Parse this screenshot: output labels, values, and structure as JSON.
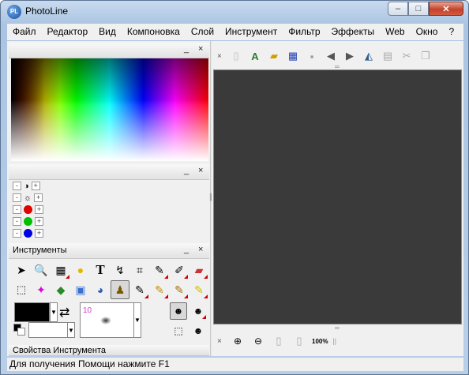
{
  "window": {
    "title": "PhotoLine",
    "app_icon": "PL"
  },
  "window_controls": {
    "minimize": "–",
    "maximize": "□",
    "close": "✕"
  },
  "menu": [
    "Файл",
    "Редактор",
    "Вид",
    "Компоновка",
    "Слой",
    "Инструмент",
    "Фильтр",
    "Эффекты",
    "Web",
    "Окно",
    "?"
  ],
  "panels": {
    "color": {
      "minimize": "_",
      "close": "×"
    },
    "adjust": {
      "minimize": "_",
      "close": "×",
      "rows": [
        {
          "name": "contrast",
          "glyph": "◑"
        },
        {
          "name": "brightness",
          "glyph": "☼"
        },
        {
          "name": "red",
          "color": "#e00000"
        },
        {
          "name": "green",
          "color": "#00c000"
        },
        {
          "name": "blue",
          "color": "#0000e0"
        }
      ],
      "minus": "-",
      "plus": "+"
    },
    "tools": {
      "title": "Инструменты",
      "minimize": "_",
      "close": "×",
      "brush_size": "10"
    },
    "tool_props": {
      "title": "Свойства Инструмента",
      "minimize": "_",
      "close": "×"
    }
  },
  "toolbar": {
    "collapse": "×"
  },
  "bottom_toolbar": {
    "zoom": "100%"
  },
  "status": {
    "text": "Для получения Помощи нажмите F1"
  },
  "colors": {
    "canvas": "#3a3a3a",
    "foreground": "#000000",
    "background": "#ffffff"
  }
}
